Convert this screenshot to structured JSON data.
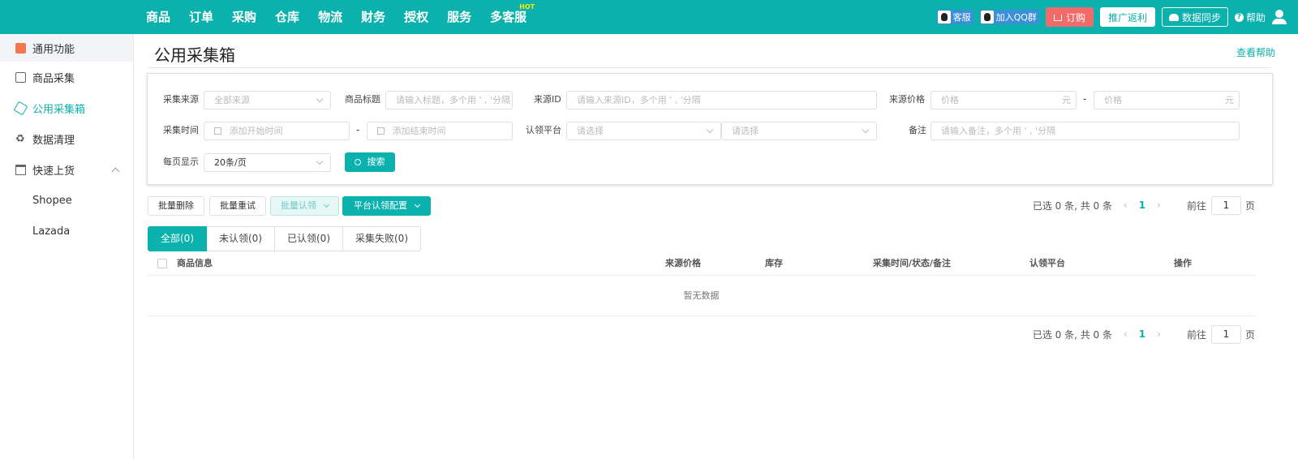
{
  "topnav": {
    "items": [
      "商品",
      "订单",
      "采购",
      "仓库",
      "物流",
      "财务",
      "授权",
      "服务",
      "多客服"
    ],
    "hot_badge": "HOT",
    "customer_service": "客服",
    "join_qq": "加入QQ群",
    "order": "订购",
    "promo": "推广返利",
    "sync": "数据同步",
    "help": "帮助"
  },
  "sidebar": {
    "header": "通用功能",
    "items": [
      "商品采集",
      "公用采集箱",
      "数据清理",
      "快速上货"
    ],
    "subitems": [
      "Shopee",
      "Lazada"
    ]
  },
  "page": {
    "title": "公用采集箱",
    "help": "查看帮助"
  },
  "filters": {
    "source_label": "采集来源",
    "source_value": "全部来源",
    "title_label": "商品标题",
    "title_placeholder": "请输入标题，多个用 ' , '分隔",
    "source_id_label": "来源ID",
    "source_id_placeholder": "请输入来源ID，多个用 ' , '分隔",
    "price_label": "来源价格",
    "price_placeholder": "价格",
    "price_unit": "元",
    "time_label": "采集时间",
    "start_placeholder": "添加开始时间",
    "end_placeholder": "添加结束时间",
    "platform_label": "认领平台",
    "platform_placeholder": "请选择",
    "note_label": "备注",
    "note_placeholder": "请输入备注，多个用 ' , '分隔",
    "per_page_label": "每页显示",
    "per_page_value": "20条/页",
    "search": "搜索",
    "dash": "-"
  },
  "actions": {
    "batch_delete": "批量删除",
    "batch_retry": "批量重试",
    "batch_claim": "批量认领",
    "platform_config": "平台认领配置"
  },
  "pager": {
    "summary": "已选 0 条, 共 0 条",
    "current": "1",
    "goto": "前往",
    "page_input": "1",
    "page_unit": "页",
    "prev": "‹",
    "next": "›"
  },
  "tabs": [
    "全部(0)",
    "未认领(0)",
    "已认领(0)",
    "采集失败(0)"
  ],
  "table": {
    "columns": [
      "商品信息",
      "来源价格",
      "库存",
      "采集时间/状态/备注",
      "认领平台",
      "操作"
    ],
    "empty": "暂无数据"
  },
  "colors": {
    "accent": "#0bb1ad",
    "order": "#f26b6b"
  }
}
